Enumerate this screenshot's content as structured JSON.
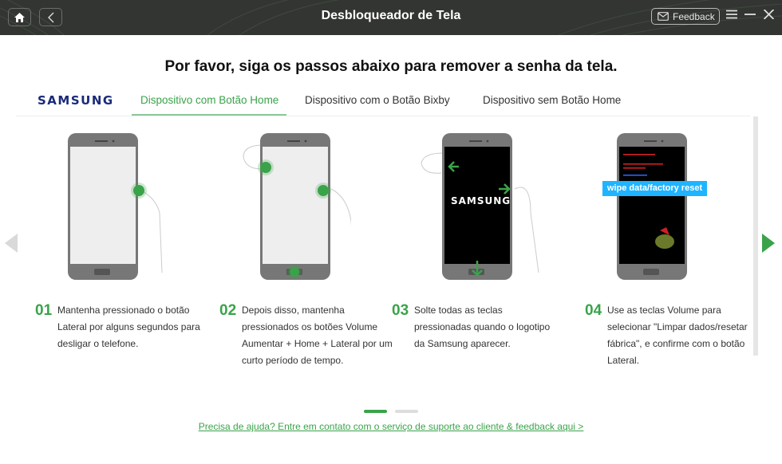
{
  "titlebar": {
    "title": "Desbloqueador de Tela",
    "feedback_label": "Feedback",
    "icons": [
      "home-icon",
      "back-icon",
      "mail-icon",
      "menu-icon",
      "minimize-icon",
      "close-icon"
    ]
  },
  "heading": "Por favor, siga os passos abaixo para remover a senha da tela.",
  "brand": "SAMSUNG",
  "tabs": [
    {
      "label": "Dispositivo com Botão Home",
      "active": true
    },
    {
      "label": "Dispositivo com o Botão Bixby",
      "active": false
    },
    {
      "label": "Dispositivo sem Botão Home",
      "active": false
    }
  ],
  "phone_screens": {
    "samsung_logo": "SAMSUNG",
    "recovery_option": "wipe data/factory reset"
  },
  "steps": [
    {
      "number": "01",
      "text": "Mantenha pressionado o botão Lateral por alguns segundos para desligar o telefone."
    },
    {
      "number": "02",
      "text": "Depois disso, mantenha pressionados os botões Volume Aumentar + Home + Lateral por um curto período de tempo."
    },
    {
      "number": "03",
      "text": "Solte todas as teclas pressionadas quando o logotipo da Samsung aparecer."
    },
    {
      "number": "04",
      "text": "Use as teclas Volume para selecionar \"Limpar dados/resetar fábrica\", e confirme com o botão Lateral."
    }
  ],
  "pagination": {
    "current": 1,
    "total": 2
  },
  "help_link": "Precisa de ajuda? Entre em contato com o serviço de suporte ao cliente & feedback aqui >",
  "colors": {
    "accent": "#3aa34a",
    "titlebar": "#333532",
    "recovery_highlight": "#1fb4ff"
  }
}
